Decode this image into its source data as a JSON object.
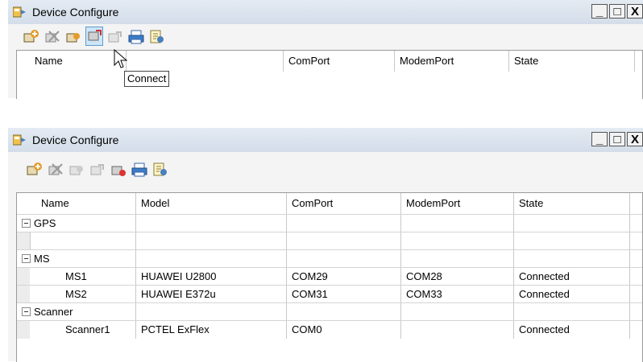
{
  "top_window": {
    "title": "Device Configure",
    "window_buttons": [
      "_",
      "□",
      "X"
    ],
    "tooltip": "Connect",
    "columns": [
      "Name",
      "",
      "ComPort",
      "ModemPort",
      "State"
    ]
  },
  "bottom_window": {
    "title": "Device Configure",
    "window_buttons": [
      "_",
      "□",
      "X"
    ],
    "columns": [
      "Name",
      "Model",
      "ComPort",
      "ModemPort",
      "State"
    ],
    "groups": [
      {
        "label": "GPS",
        "children": []
      },
      {
        "label": "MS",
        "children": [
          {
            "name": "MS1",
            "model": "HUAWEI U2800",
            "comport": "COM29",
            "modemport": "COM28",
            "state": "Connected"
          },
          {
            "name": "MS2",
            "model": "HUAWEI E372u",
            "comport": "COM31",
            "modemport": "COM33",
            "state": "Connected"
          }
        ]
      },
      {
        "label": "Scanner",
        "children": [
          {
            "name": "Scanner1",
            "model": "PCTEL ExFlex",
            "comport": "COM0",
            "modemport": "",
            "state": "Connected"
          }
        ]
      }
    ]
  },
  "toolbar_icons": [
    "add-device-icon",
    "remove-device-icon",
    "edit-device-icon",
    "connect-icon",
    "disconnect-icon",
    "print-icon",
    "properties-icon"
  ],
  "colors": {
    "titlebar": "#d3dde9",
    "hover_button": "#cde6f7",
    "hover_border": "#5c9bd1"
  }
}
